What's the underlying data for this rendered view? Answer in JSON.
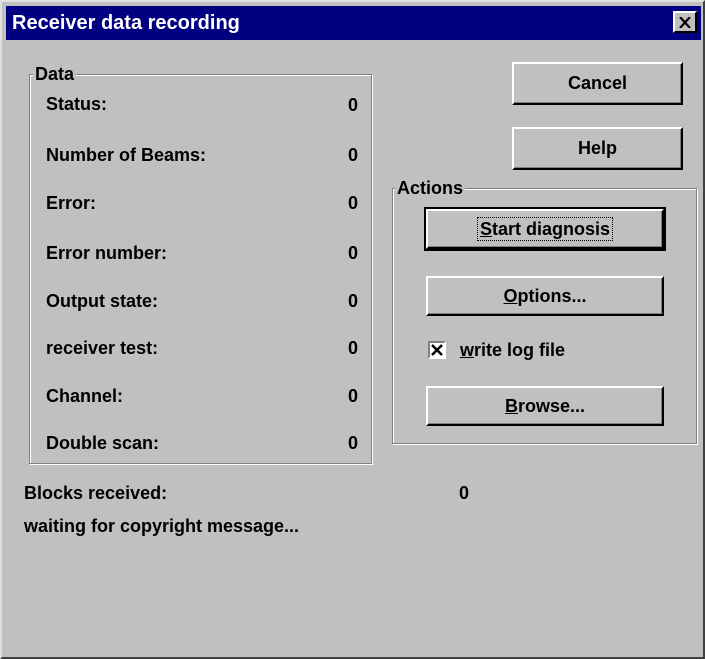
{
  "window": {
    "title": "Receiver data recording",
    "close_icon": "close-icon"
  },
  "data_group": {
    "label": "Data",
    "rows": [
      {
        "label": "Status:",
        "value": "0"
      },
      {
        "label": "Number of Beams:",
        "value": "0"
      },
      {
        "label": "Error:",
        "value": "0"
      },
      {
        "label": "Error number:",
        "value": "0"
      },
      {
        "label": "Output state:",
        "value": "0"
      },
      {
        "label": "receiver test:",
        "value": "0"
      },
      {
        "label": "Channel:",
        "value": "0"
      },
      {
        "label": "Double scan:",
        "value": "0"
      }
    ]
  },
  "buttons": {
    "cancel": "Cancel",
    "help": "Help"
  },
  "actions_group": {
    "label": "Actions",
    "start_diagnosis": {
      "mnemonic": "S",
      "rest": "tart diagnosis"
    },
    "options": {
      "mnemonic": "O",
      "rest": "ptions..."
    },
    "write_log": {
      "mnemonic": "w",
      "rest": "rite log file",
      "checked": true
    },
    "browse": {
      "mnemonic": "B",
      "rest": "rowse..."
    }
  },
  "status": {
    "blocks_label": "Blocks received:",
    "blocks_value": "0",
    "message": "waiting for copyright message..."
  }
}
